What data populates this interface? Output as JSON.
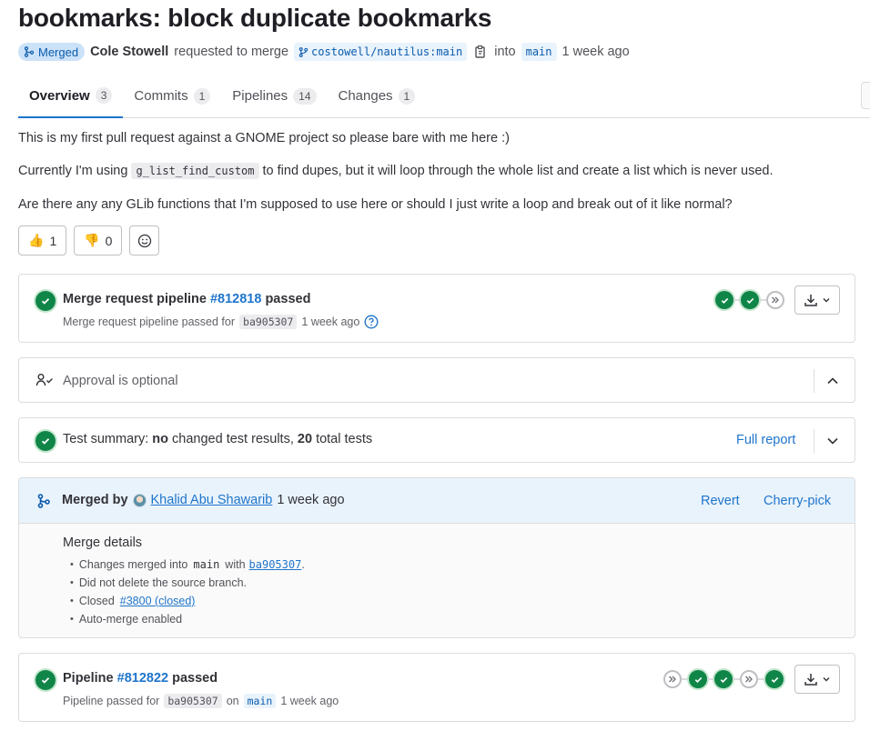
{
  "mr": {
    "title": "bookmarks: block duplicate bookmarks",
    "status": "Merged",
    "author": "Cole Stowell",
    "requested_text": "requested to merge",
    "source_branch": "costowell/nautilus:main",
    "into_text": "into",
    "target_branch": "main",
    "time_ago": "1 week ago"
  },
  "tabs": [
    {
      "label": "Overview",
      "count": "3"
    },
    {
      "label": "Commits",
      "count": "1"
    },
    {
      "label": "Pipelines",
      "count": "14"
    },
    {
      "label": "Changes",
      "count": "1"
    }
  ],
  "description": {
    "p1": "This is my first pull request against a GNOME project so please bare with me here :)",
    "p2_before": "Currently I'm using",
    "p2_code": "g_list_find_custom",
    "p2_after": "to find dupes, but it will loop through the whole list and create a list which is never used.",
    "p3": "Are there any any GLib functions that I'm supposed to use here or should I just write a loop and break out of it like normal?"
  },
  "reactions": {
    "thumbs_up": {
      "emoji": "👍",
      "count": "1"
    },
    "thumbs_down": {
      "emoji": "👎",
      "count": "0"
    }
  },
  "mr_pipeline": {
    "title_prefix": "Merge request pipeline",
    "id": "#812818",
    "status": "passed",
    "sub_prefix": "Merge request pipeline passed for",
    "sha": "ba905307",
    "time": "1 week ago"
  },
  "approval": {
    "text": "Approval is optional"
  },
  "tests": {
    "prefix": "Test summary:",
    "no": "no",
    "mid": "changed test results,",
    "total": "20",
    "suffix": "total tests",
    "full_report": "Full report"
  },
  "merged": {
    "by_label": "Merged by",
    "user": "Khalid Abu Shawarib",
    "time": "1 week ago",
    "revert": "Revert",
    "cherry_pick": "Cherry-pick",
    "details_title": "Merge details",
    "d1_prefix": "Changes merged into",
    "d1_branch": "main",
    "d1_with": "with",
    "d1_sha": "ba905307",
    "d2": "Did not delete the source branch.",
    "d3_prefix": "Closed",
    "d3_link": "#3800 (closed)",
    "d4": "Auto-merge enabled"
  },
  "pipeline": {
    "title_prefix": "Pipeline",
    "id": "#812822",
    "status": "passed",
    "sub_prefix": "Pipeline passed for",
    "sha": "ba905307",
    "on": "on",
    "branch": "main",
    "time": "1 week ago"
  },
  "colors": {
    "success": "#108548",
    "link": "#1f75cb",
    "merged_badge_bg": "#cbe2f9",
    "merged_header_bg": "#e9f3fc"
  }
}
